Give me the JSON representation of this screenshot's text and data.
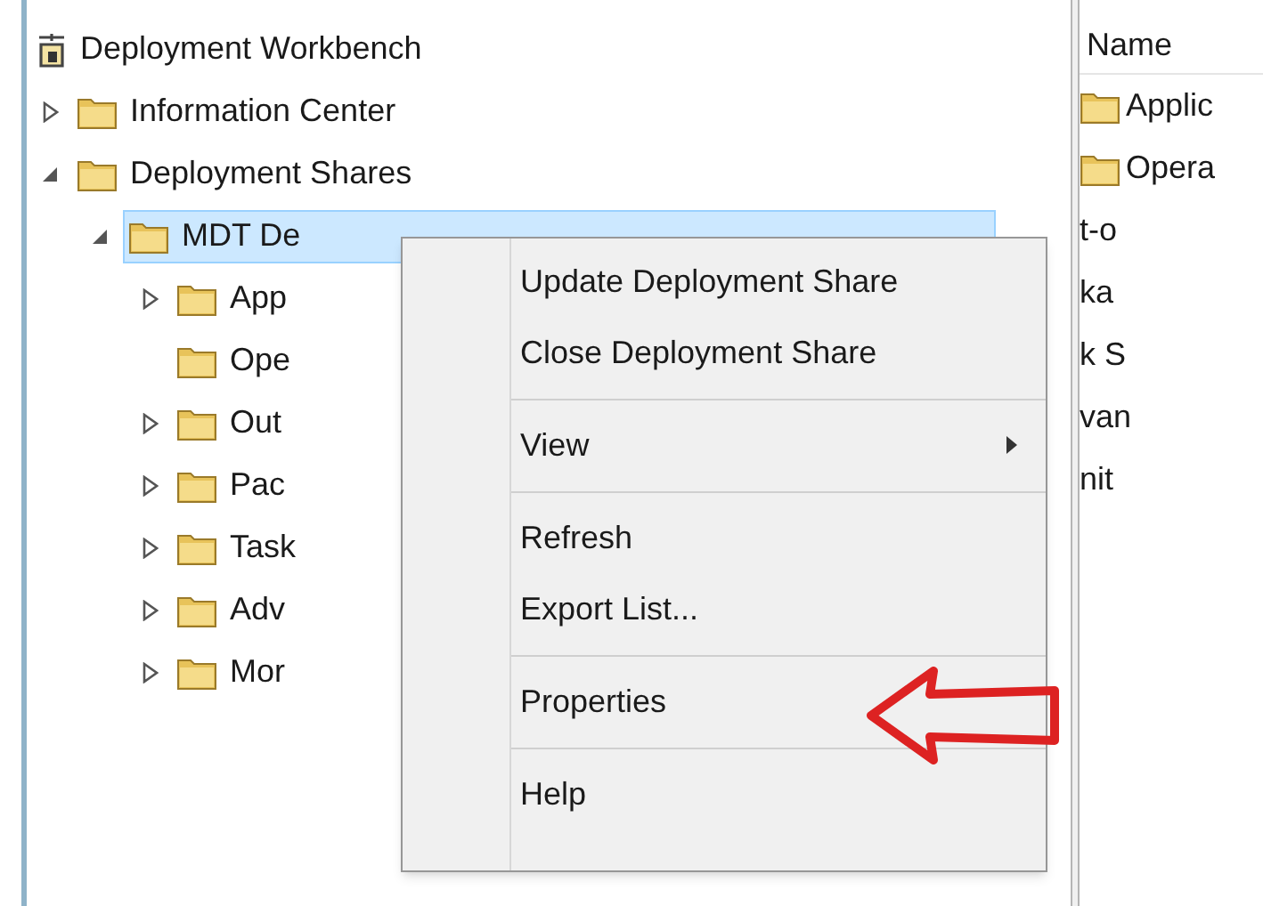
{
  "tree": [
    {
      "label": "Deployment Workbench",
      "expandable": false,
      "selected": false,
      "children": [
        {
          "label": "Information Center",
          "expandable": true,
          "expanded": false,
          "selected": false
        },
        {
          "label": "Deployment Shares",
          "expandable": true,
          "expanded": true,
          "selected": false,
          "children": [
            {
              "label": "MDT De",
              "expandable": true,
              "expanded": true,
              "selected": true,
              "children": [
                {
                  "label": "App",
                  "expandable": true,
                  "expanded": false,
                  "selected": false
                },
                {
                  "label": "Ope",
                  "expandable": false,
                  "selected": false
                },
                {
                  "label": "Out",
                  "expandable": true,
                  "expanded": false,
                  "selected": false
                },
                {
                  "label": "Pac",
                  "expandable": true,
                  "expanded": false,
                  "selected": false
                },
                {
                  "label": "Task",
                  "expandable": true,
                  "expanded": false,
                  "selected": false
                },
                {
                  "label": "Adv",
                  "expandable": true,
                  "expanded": false,
                  "selected": false
                },
                {
                  "label": "Mor",
                  "expandable": true,
                  "expanded": false,
                  "selected": false
                }
              ]
            }
          ]
        }
      ]
    }
  ],
  "list": {
    "column": "Name",
    "rows": [
      {
        "name": "Applic",
        "covered": false
      },
      {
        "name": "Opera",
        "covered": false
      },
      {
        "name": "t-o",
        "covered": true
      },
      {
        "name": "ka",
        "covered": true
      },
      {
        "name": "k S",
        "covered": true
      },
      {
        "name": "van",
        "covered": true
      },
      {
        "name": "nit",
        "covered": true
      }
    ]
  },
  "context_menu": [
    {
      "kind": "item",
      "label": "Update Deployment Share",
      "submenu": false
    },
    {
      "kind": "item",
      "label": "Close Deployment Share",
      "submenu": false
    },
    {
      "kind": "separator"
    },
    {
      "kind": "item",
      "label": "View",
      "submenu": true
    },
    {
      "kind": "separator"
    },
    {
      "kind": "item",
      "label": "Refresh",
      "submenu": false
    },
    {
      "kind": "item",
      "label": "Export List...",
      "submenu": false
    },
    {
      "kind": "separator"
    },
    {
      "kind": "item",
      "label": "Properties",
      "submenu": false
    },
    {
      "kind": "separator"
    },
    {
      "kind": "item",
      "label": "Help",
      "submenu": false
    }
  ]
}
